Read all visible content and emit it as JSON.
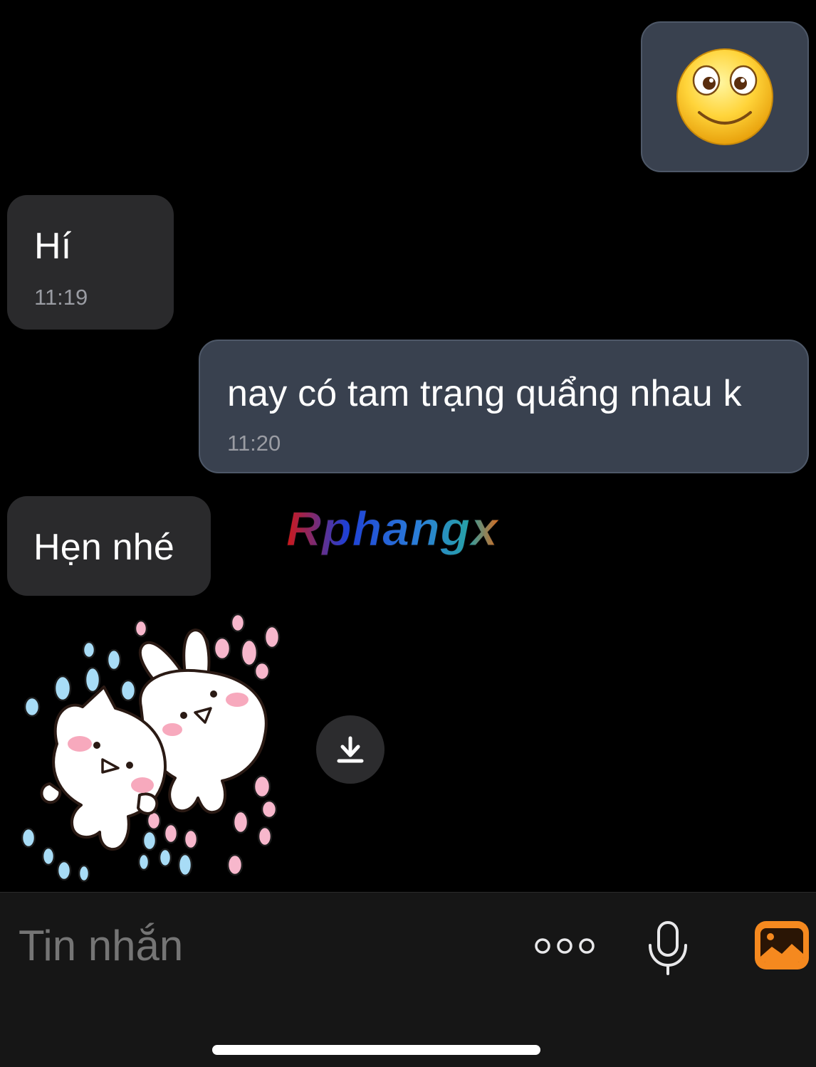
{
  "messages": [
    {
      "direction": "outgoing",
      "type": "emoji",
      "icon": "smiley-face-icon"
    },
    {
      "direction": "incoming",
      "type": "text",
      "text": "Hí",
      "time": "11:19"
    },
    {
      "direction": "outgoing",
      "type": "text",
      "text": "nay có tam trạng quẩng nhau k",
      "time": "11:20"
    },
    {
      "direction": "incoming",
      "type": "text",
      "text": "Hẹn nhé"
    },
    {
      "direction": "incoming",
      "type": "sticker",
      "icon": "cat-and-bunny-hug-sticker"
    }
  ],
  "watermark": "Rphangx",
  "composer": {
    "placeholder": "Tin nhắn",
    "more_icon": "more-dots-icon",
    "mic_icon": "microphone-icon",
    "gallery_icon": "gallery-icon",
    "accent_color": "#f5891f"
  },
  "colors": {
    "background": "#000000",
    "incoming_bubble": "#2a2a2c",
    "outgoing_bubble": "#39414f"
  }
}
